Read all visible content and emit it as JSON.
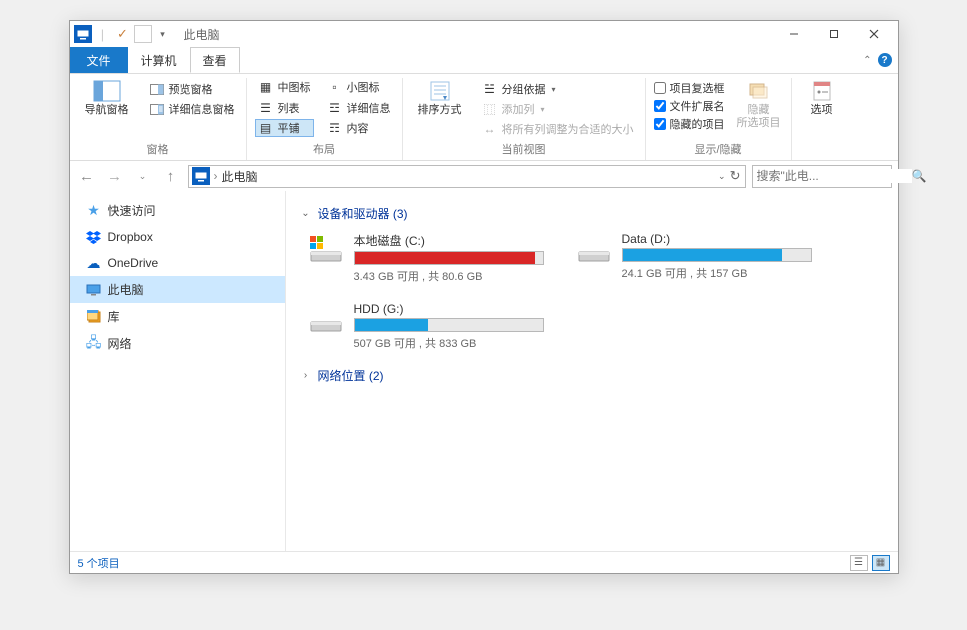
{
  "title": "此电脑",
  "tabs": {
    "file": "文件",
    "computer": "计算机",
    "view": "查看"
  },
  "ribbon": {
    "panes": {
      "nav_btn": "导航窗格",
      "preview": "预览窗格",
      "details": "详细信息窗格",
      "label": "窗格"
    },
    "layout": {
      "opts": [
        "中图标",
        "小图标",
        "列表",
        "详细信息",
        "平铺",
        "内容"
      ],
      "label": "布局"
    },
    "currentview": {
      "sort": "排序方式",
      "groupby": "分组依据",
      "addcol": "添加列",
      "fit": "将所有列调整为合适的大小",
      "label": "当前视图"
    },
    "showhide": {
      "chk1": "项目复选框",
      "chk2": "文件扩展名",
      "chk3": "隐藏的项目",
      "hide": "隐藏",
      "hide2": "所选项目",
      "label": "显示/隐藏"
    },
    "options": "选项"
  },
  "address": {
    "location": "此电脑"
  },
  "search_placeholder": "搜索\"此电...",
  "nav": [
    {
      "icon": "star",
      "label": "快速访问"
    },
    {
      "icon": "dropbox",
      "label": "Dropbox"
    },
    {
      "icon": "onedrive",
      "label": "OneDrive"
    },
    {
      "icon": "pc",
      "label": "此电脑",
      "sel": true
    },
    {
      "icon": "lib",
      "label": "库"
    },
    {
      "icon": "net",
      "label": "网络"
    }
  ],
  "groups": {
    "devices": {
      "label": "设备和驱动器 (3)",
      "expanded": true
    },
    "netloc": {
      "label": "网络位置 (2)",
      "expanded": false
    }
  },
  "drives": [
    {
      "name": "本地磁盘 (C:)",
      "free": "3.43 GB 可用 , 共 80.6 GB",
      "pct": 96,
      "critical": true,
      "os": true
    },
    {
      "name": "Data (D:)",
      "free": "24.1 GB 可用 , 共 157 GB",
      "pct": 85,
      "critical": false,
      "os": false
    },
    {
      "name": "HDD (G:)",
      "free": "507 GB 可用 , 共 833 GB",
      "pct": 39,
      "critical": false,
      "os": false
    }
  ],
  "status": "5 个项目"
}
